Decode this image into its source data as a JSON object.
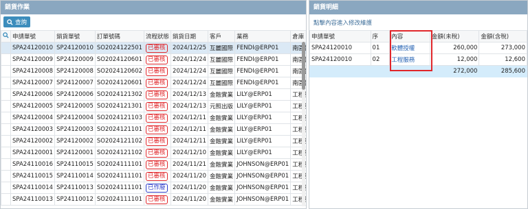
{
  "left": {
    "title": "銷貨作業",
    "query_label": "查詢",
    "columns": [
      "申請單號",
      "銷貨單號",
      "訂單號碼",
      "流程狀態",
      "銷貨日期",
      "客戶",
      "業務",
      "倉庫"
    ],
    "rows": [
      {
        "app": "SPA24120010",
        "sale": "SP24120010",
        "order": "SO2024122501",
        "status": "已審核",
        "date": "2024/12/25",
        "cust": "互麗國際",
        "rep": "FENDI@ERP01",
        "wh": "南區營運",
        "selected": true
      },
      {
        "app": "SPA24120009",
        "sale": "SP24120009",
        "order": "SO2024120601",
        "status": "已審核",
        "date": "2024/12/24",
        "cust": "互麗國際",
        "rep": "FENDI@ERP01",
        "wh": "南區營運"
      },
      {
        "app": "SPA24120008",
        "sale": "SP24120008",
        "order": "SO2024120602",
        "status": "已審核",
        "date": "2024/12/24",
        "cust": "互麗國際",
        "rep": "FENDI@ERP01",
        "wh": "南區營運"
      },
      {
        "app": "SPA24120007",
        "sale": "SP24120007",
        "order": "SO2024120601",
        "status": "已審核",
        "date": "2024/12/24",
        "cust": "互麗國際",
        "rep": "FENDI@ERP01",
        "wh": "南區營運"
      },
      {
        "app": "SPA24120006",
        "sale": "SP24120006",
        "order": "SO2024121302",
        "status": "已審核",
        "date": "2024/12/13",
        "cust": "金融實業",
        "rep": "LILY@ERP01",
        "wh": "工程部(一"
      },
      {
        "app": "SPA24120005",
        "sale": "SP24120005",
        "order": "SO2024121301",
        "status": "已審核",
        "date": "2024/12/13",
        "cust": "元照出版",
        "rep": "LILY@ERP01",
        "wh": "工程部(一"
      },
      {
        "app": "SPA24120004",
        "sale": "SP24120004",
        "order": "SO2024121103",
        "status": "已審核",
        "date": "2024/12/11",
        "cust": "金融實業",
        "rep": "LILY@ERP01",
        "wh": "工程部(一"
      },
      {
        "app": "SPA24120003",
        "sale": "SP24120003",
        "order": "SO2024121101",
        "status": "已審核",
        "date": "2024/12/11",
        "cust": "金融實業",
        "rep": "LILY@ERP01",
        "wh": "工程部(一"
      },
      {
        "app": "SPA24120002",
        "sale": "SP24120002",
        "order": "SO2024121102",
        "status": "已審核",
        "date": "2024/12/11",
        "cust": "金融實業",
        "rep": "LILY@ERP01",
        "wh": "工程部(一"
      },
      {
        "app": "SPA24120001",
        "sale": "SP24120001",
        "order": "SO2024121102",
        "status": "已審核",
        "date": "2024/12/10",
        "cust": "金融實業",
        "rep": "LILY@ERP01",
        "wh": "工程部(一"
      },
      {
        "app": "SPA24110016",
        "sale": "SP24110015",
        "order": "SO2024111101",
        "status": "已審核",
        "date": "2024/11/21",
        "cust": "金融實業",
        "rep": "JOHNSON@ERP01",
        "wh": "工程部(一"
      },
      {
        "app": "SPA24110015",
        "sale": "SP24110014",
        "order": "SO2024111101",
        "status": "已審核",
        "date": "2024/11/20",
        "cust": "金融實業",
        "rep": "JOHNSON@ERP01",
        "wh": "工程部(一"
      },
      {
        "app": "SPA24110014",
        "sale": "SP24110013",
        "order": "SO2024111101",
        "status": "已作廢",
        "date": "2024/11/20",
        "cust": "金融實業",
        "rep": "JOHNSON@ERP01",
        "wh": "工程部(一",
        "blue": true
      },
      {
        "app": "SPA24110013",
        "sale": "SP24110012",
        "order": "SO2024111101",
        "status": "已審核",
        "date": "2024/11/20",
        "cust": "金融實業",
        "rep": "JOHNSON@ERP01",
        "wh": "工程部(一"
      }
    ]
  },
  "right": {
    "title": "銷貨明細",
    "hint": "點擊內容進入修改維護",
    "columns": [
      "申請單號",
      "序",
      "內容",
      "金額(未稅)",
      "金額(含稅)"
    ],
    "rows": [
      {
        "app": "SPA24120010",
        "seq": "01",
        "content": "軟體授權",
        "net": "260,000",
        "gross": "273,000"
      },
      {
        "app": "SPA24120010",
        "seq": "02",
        "content": "工程服務",
        "net": "12,000",
        "gross": "12,600"
      }
    ],
    "totals": {
      "net": "272,000",
      "gross": "285,600"
    }
  }
}
